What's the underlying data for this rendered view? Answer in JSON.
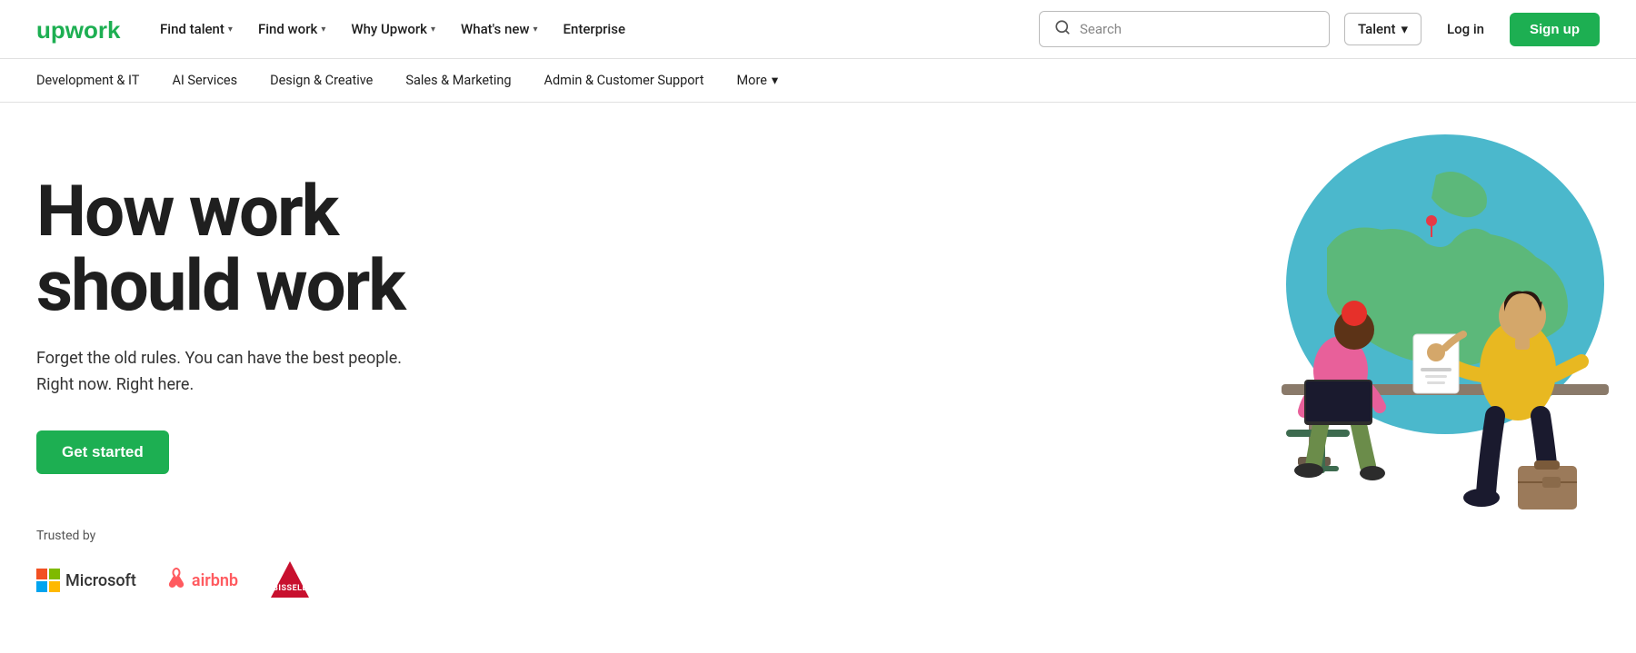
{
  "logo": {
    "text": "upwork"
  },
  "topNav": {
    "links": [
      {
        "label": "Find talent",
        "hasDropdown": true
      },
      {
        "label": "Find work",
        "hasDropdown": true
      },
      {
        "label": "Why Upwork",
        "hasDropdown": true
      },
      {
        "label": "What's new",
        "hasDropdown": true
      },
      {
        "label": "Enterprise",
        "hasDropdown": false
      }
    ],
    "search": {
      "placeholder": "Search",
      "icon": "search"
    },
    "talentSelect": {
      "label": "Talent",
      "hasDropdown": true
    },
    "loginLabel": "Log in",
    "signupLabel": "Sign up"
  },
  "subNav": {
    "items": [
      "Development & IT",
      "AI Services",
      "Design & Creative",
      "Sales & Marketing",
      "Admin & Customer Support"
    ],
    "moreLabel": "More"
  },
  "hero": {
    "headline": "How work\nshould work",
    "subtext": "Forget the old rules. You can have the best people.\nRight now. Right here.",
    "ctaLabel": "Get started"
  },
  "trusted": {
    "label": "Trusted by",
    "logos": [
      "Microsoft",
      "airbnb",
      "BISSELL"
    ]
  }
}
